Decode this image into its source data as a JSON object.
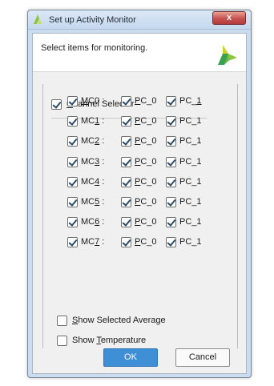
{
  "window": {
    "title": "Set up Activity Monitor",
    "close_glyph": "x"
  },
  "header": {
    "instruction": "Select items for monitoring."
  },
  "channel_selector": {
    "label_underlined": "C",
    "label_rest": "hannel Selector",
    "checked": true
  },
  "channels": [
    {
      "pre": "",
      "u": "M",
      "post": "C0 :",
      "pc0": {
        "u": "P",
        "post": "C_0"
      },
      "pc1": {
        "pre": "PC_",
        "u": "1",
        "post": ""
      }
    },
    {
      "pre": "MC",
      "u": "1",
      "post": " :",
      "pc0": {
        "u": "P",
        "post": "C_0"
      },
      "pc1": {
        "pre": "PC_1",
        "u": "",
        "post": ""
      }
    },
    {
      "pre": "MC",
      "u": "2",
      "post": " :",
      "pc0": {
        "u": "P",
        "post": "C_0"
      },
      "pc1": {
        "pre": "PC_1",
        "u": "",
        "post": ""
      }
    },
    {
      "pre": "MC",
      "u": "3",
      "post": " :",
      "pc0": {
        "u": "P",
        "post": "C_0"
      },
      "pc1": {
        "pre": "PC_1",
        "u": "",
        "post": ""
      }
    },
    {
      "pre": "MC",
      "u": "4",
      "post": " :",
      "pc0": {
        "u": "P",
        "post": "C_0"
      },
      "pc1": {
        "pre": "PC_1",
        "u": "",
        "post": ""
      }
    },
    {
      "pre": "MC",
      "u": "5",
      "post": " :",
      "pc0": {
        "u": "P",
        "post": "C_0"
      },
      "pc1": {
        "pre": "PC_1",
        "u": "",
        "post": ""
      }
    },
    {
      "pre": "MC",
      "u": "6",
      "post": " :",
      "pc0": {
        "u": "P",
        "post": "C_0"
      },
      "pc1": {
        "pre": "PC_1",
        "u": "",
        "post": ""
      }
    },
    {
      "pre": "MC",
      "u": "7",
      "post": " :",
      "pc0": {
        "u": "P",
        "post": "C_0"
      },
      "pc1": {
        "pre": "PC_1",
        "u": "",
        "post": ""
      }
    }
  ],
  "options": {
    "show_selected_average": {
      "u": "S",
      "post": "how Selected Average",
      "checked": false
    },
    "show_temperature": {
      "pre": "Show ",
      "u": "T",
      "post": "emperature",
      "checked": false
    }
  },
  "buttons": {
    "ok": "OK",
    "cancel": "Cancel"
  },
  "colors": {
    "ok_button": "#3f8fd6",
    "logo": "#8dc63f"
  },
  "icons": {
    "title": "app-logo-icon",
    "close": "close-icon",
    "brand": "brand-logo-icon"
  }
}
